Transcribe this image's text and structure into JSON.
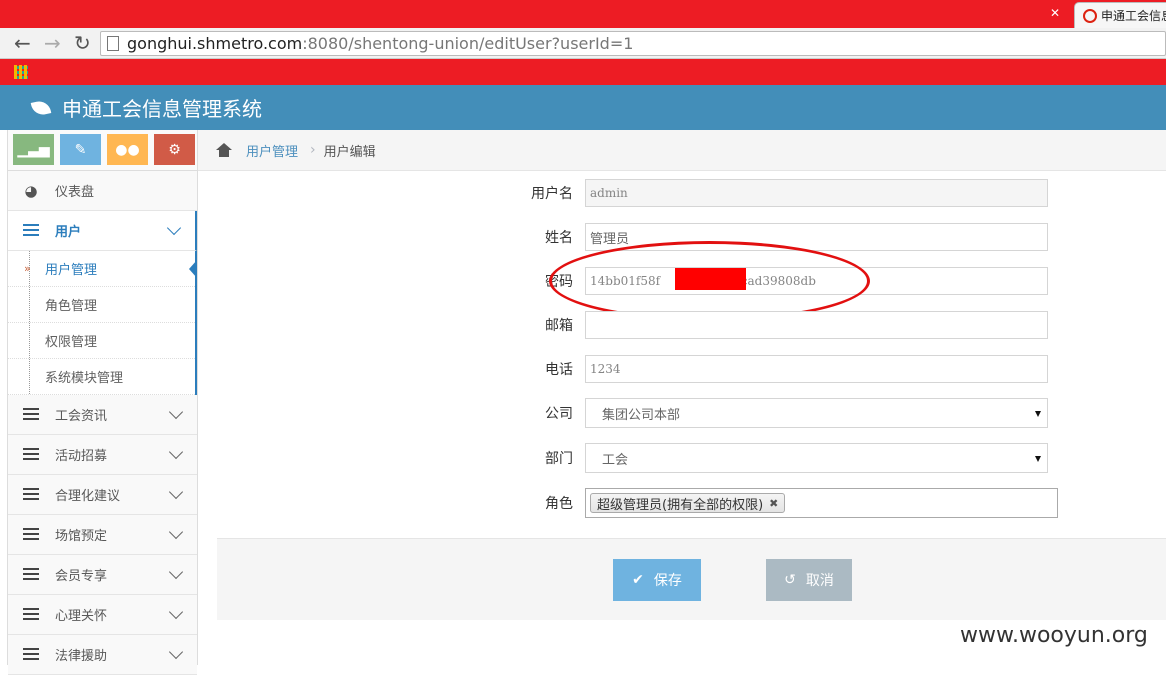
{
  "browser": {
    "tab_title": "申通工会信息",
    "url_host": "gonghui.shmetro.com",
    "url_path": ":8080/shentong-union/editUser?userId=1"
  },
  "app": {
    "title": "申通工会信息管理系统",
    "header_color": "#438eb9"
  },
  "sidebar": {
    "shortcuts": [
      {
        "icon": "signal-icon",
        "color": "#87b87f"
      },
      {
        "icon": "pencil-icon",
        "color": "#6fb3e0"
      },
      {
        "icon": "users-icon",
        "color": "#ffb752"
      },
      {
        "icon": "cogs-icon",
        "color": "#d15b47"
      }
    ],
    "dashboard": "仪表盘",
    "users": "用户",
    "submenu": [
      "用户管理",
      "角色管理",
      "权限管理",
      "系统模块管理"
    ],
    "items": [
      "工会资讯",
      "活动招募",
      "合理化建议",
      "场馆预定",
      "会员专享",
      "心理关怀",
      "法律援助"
    ]
  },
  "breadcrumb": {
    "parent": "用户管理",
    "current": "用户编辑"
  },
  "form": {
    "username_label": "用户名",
    "username_value": "admin",
    "name_label": "姓名",
    "name_value": "管理员",
    "password_label": "密码",
    "password_prefix": "14bb01f58f",
    "password_suffix": "ccad39808db",
    "email_label": "邮箱",
    "email_value": "",
    "phone_label": "电话",
    "phone_value": "1234",
    "company_label": "公司",
    "company_value": "集团公司本部",
    "department_label": "部门",
    "department_value": "工会",
    "role_label": "角色",
    "role_tag": "超级管理员(拥有全部的权限)"
  },
  "actions": {
    "save": "保存",
    "cancel": "取消"
  },
  "watermark": "www.wooyun.org"
}
